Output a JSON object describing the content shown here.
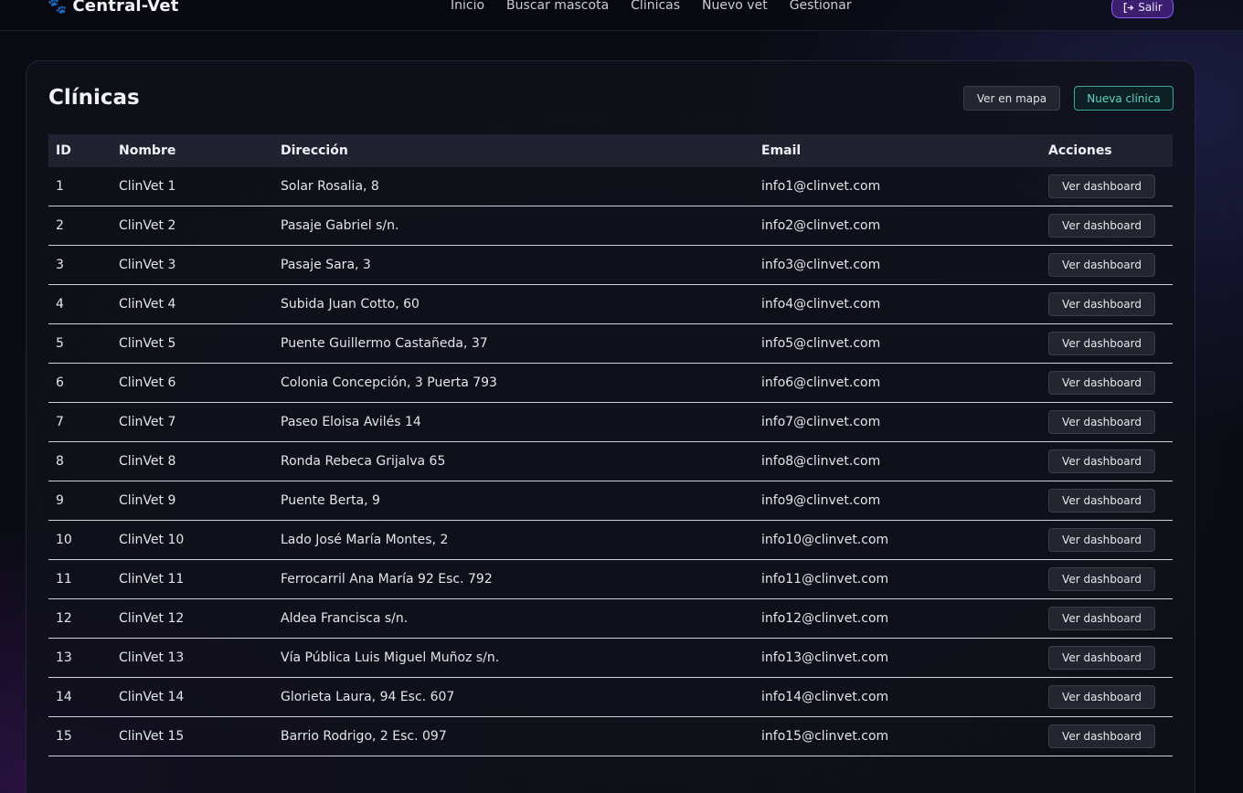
{
  "navbar": {
    "brand": "Central-Vet",
    "brand_icon": "paw-icon",
    "links": [
      "Inicio",
      "Buscar mascota",
      "Clínicas",
      "Nuevo vet",
      "Gestionar"
    ],
    "logout_label": "Salir"
  },
  "page": {
    "title": "Clínicas",
    "map_button": "Ver en mapa",
    "new_button": "Nueva clínica"
  },
  "table": {
    "headers": [
      "ID",
      "Nombre",
      "Dirección",
      "Email",
      "Acciones"
    ],
    "action_label": "Ver dashboard",
    "rows": [
      {
        "id": "1",
        "name": "ClinVet 1",
        "address": "Solar Rosalia, 8",
        "email": "info1@clinvet.com"
      },
      {
        "id": "2",
        "name": "ClinVet 2",
        "address": "Pasaje Gabriel s/n.",
        "email": "info2@clinvet.com"
      },
      {
        "id": "3",
        "name": "ClinVet 3",
        "address": "Pasaje Sara, 3",
        "email": "info3@clinvet.com"
      },
      {
        "id": "4",
        "name": "ClinVet 4",
        "address": "Subida Juan Cotto, 60",
        "email": "info4@clinvet.com"
      },
      {
        "id": "5",
        "name": "ClinVet 5",
        "address": "Puente Guillermo Castañeda, 37",
        "email": "info5@clinvet.com"
      },
      {
        "id": "6",
        "name": "ClinVet 6",
        "address": "Colonia Concepción, 3 Puerta 793",
        "email": "info6@clinvet.com"
      },
      {
        "id": "7",
        "name": "ClinVet 7",
        "address": "Paseo Eloisa Avilés 14",
        "email": "info7@clinvet.com"
      },
      {
        "id": "8",
        "name": "ClinVet 8",
        "address": "Ronda Rebeca Grijalva 65",
        "email": "info8@clinvet.com"
      },
      {
        "id": "9",
        "name": "ClinVet 9",
        "address": "Puente Berta, 9",
        "email": "info9@clinvet.com"
      },
      {
        "id": "10",
        "name": "ClinVet 10",
        "address": "Lado José María Montes, 2",
        "email": "info10@clinvet.com"
      },
      {
        "id": "11",
        "name": "ClinVet 11",
        "address": "Ferrocarril Ana María 92 Esc. 792",
        "email": "info11@clinvet.com"
      },
      {
        "id": "12",
        "name": "ClinVet 12",
        "address": "Aldea Francisca s/n.",
        "email": "info12@clinvet.com"
      },
      {
        "id": "13",
        "name": "ClinVet 13",
        "address": "Vía Pública Luis Miguel Muñoz s/n.",
        "email": "info13@clinvet.com"
      },
      {
        "id": "14",
        "name": "ClinVet 14",
        "address": "Glorieta Laura, 94 Esc. 607",
        "email": "info14@clinvet.com"
      },
      {
        "id": "15",
        "name": "ClinVet 15",
        "address": "Barrio Rodrigo, 2 Esc. 097",
        "email": "info15@clinvet.com"
      }
    ]
  },
  "colors": {
    "accent_purple": "#8b5cf6",
    "accent_teal": "#3aa79a"
  }
}
